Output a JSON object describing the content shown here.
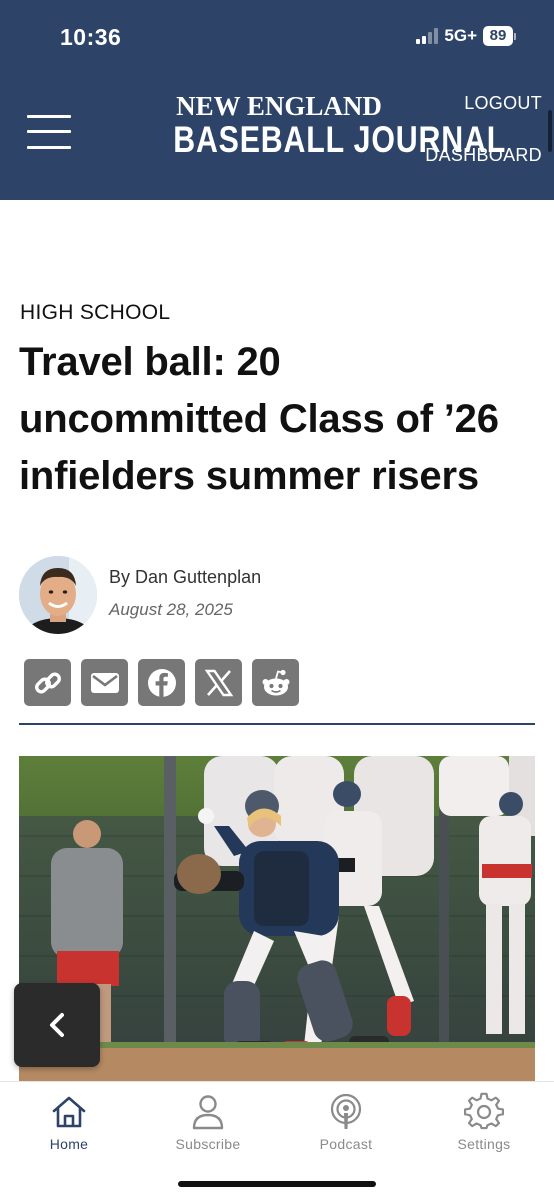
{
  "status_bar": {
    "time": "10:36",
    "network": "5G+",
    "battery": "89"
  },
  "header": {
    "logo_line1": "NEW ENGLAND",
    "logo_line2": "BASEBALL JOURNAL",
    "logout_label": "LOGOUT",
    "dashboard_label": "DASHBOARD",
    "background_color": "#2d4468"
  },
  "article": {
    "category": "HIGH SCHOOL",
    "headline": "Travel ball: 20 uncommitted Class of ’26 infielders summer risers",
    "byline": "By Dan Guttenplan",
    "date": "August 28, 2025"
  },
  "share": {
    "icons": [
      "link-icon",
      "email-icon",
      "facebook-icon",
      "x-icon",
      "reddit-icon"
    ],
    "button_color": "#777777"
  },
  "tabbar": {
    "tabs": [
      {
        "label": "Home",
        "icon": "home-icon",
        "active": true
      },
      {
        "label": "Subscribe",
        "icon": "person-icon",
        "active": false
      },
      {
        "label": "Podcast",
        "icon": "podcast-icon",
        "active": false
      },
      {
        "label": "Settings",
        "icon": "gear-icon",
        "active": false
      }
    ],
    "active_color": "#2d4468",
    "inactive_color": "#8a8a8a"
  }
}
